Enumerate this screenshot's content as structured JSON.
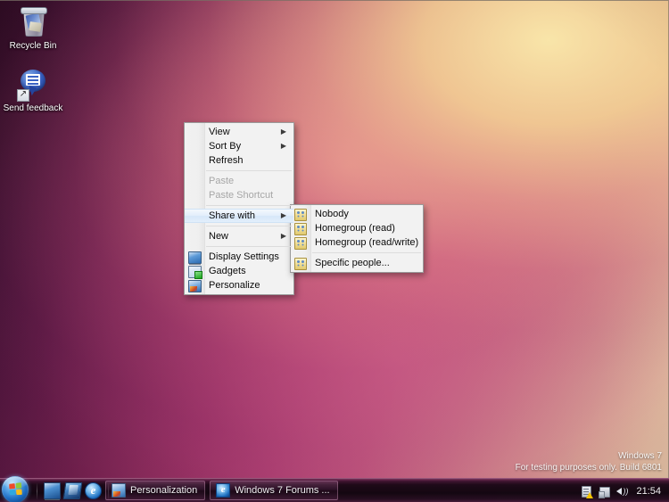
{
  "desktop": {
    "icons": [
      {
        "name": "recycle-bin",
        "label": "Recycle Bin"
      },
      {
        "name": "send-feedback",
        "label": "Send feedback"
      }
    ]
  },
  "context_menu": {
    "items": [
      {
        "label": "View",
        "icon": "",
        "arrow": "▶",
        "state": "normal"
      },
      {
        "label": "Sort By",
        "icon": "",
        "arrow": "▶",
        "state": "normal"
      },
      {
        "label": "Refresh",
        "icon": "",
        "arrow": "",
        "state": "normal"
      },
      {
        "label": "Paste",
        "icon": "",
        "arrow": "",
        "state": "disabled"
      },
      {
        "label": "Paste Shortcut",
        "icon": "",
        "arrow": "",
        "state": "disabled"
      },
      {
        "label": "Share with",
        "icon": "",
        "arrow": "▶",
        "state": "highlighted"
      },
      {
        "label": "New",
        "icon": "",
        "arrow": "▶",
        "state": "normal"
      },
      {
        "label": "Display Settings",
        "icon": "display-icon",
        "arrow": "",
        "state": "normal"
      },
      {
        "label": "Gadgets",
        "icon": "gadgets-icon",
        "arrow": "",
        "state": "normal"
      },
      {
        "label": "Personalize",
        "icon": "personalize-icon",
        "arrow": "",
        "state": "normal"
      }
    ]
  },
  "share_submenu": {
    "items": [
      {
        "label": "Nobody",
        "icon": "people-icon"
      },
      {
        "label": "Homegroup (read)",
        "icon": "people-icon"
      },
      {
        "label": "Homegroup (read/write)",
        "icon": "people-icon"
      },
      {
        "label": "Specific people...",
        "icon": "people-icon"
      }
    ]
  },
  "taskbar": {
    "start_label": "Start",
    "quick_launch": [
      {
        "name": "show-desktop-icon",
        "label": "Show desktop"
      },
      {
        "name": "switch-windows-icon",
        "label": "Switch between windows"
      },
      {
        "name": "internet-explorer-icon",
        "label": "e"
      }
    ],
    "buttons": [
      {
        "name": "taskbar-button-personalization",
        "label": "Personalization",
        "icon": "personalize-icon"
      },
      {
        "name": "taskbar-button-ie",
        "label": "Windows 7 Forums ...",
        "icon": "internet-explorer-icon",
        "icon_glyph": "e"
      }
    ],
    "tray": [
      {
        "name": "action-center-icon",
        "label": "Action Center"
      },
      {
        "name": "network-icon",
        "label": "Network"
      },
      {
        "name": "volume-icon",
        "label": "Volume"
      }
    ],
    "clock": "21:54"
  },
  "watermark": {
    "line1": "Windows 7",
    "line2": "For testing purposes only. Build 6801"
  },
  "colors": {
    "menu_bg": "#f2f2f2",
    "menu_border": "#9a9a9a",
    "highlight": "#d6e7f9",
    "disabled_text": "#a6a6a6",
    "taskbar": "#1a0816",
    "wallpaper_dark": "#2a0b20",
    "wallpaper_light": "#f0e2ae"
  }
}
